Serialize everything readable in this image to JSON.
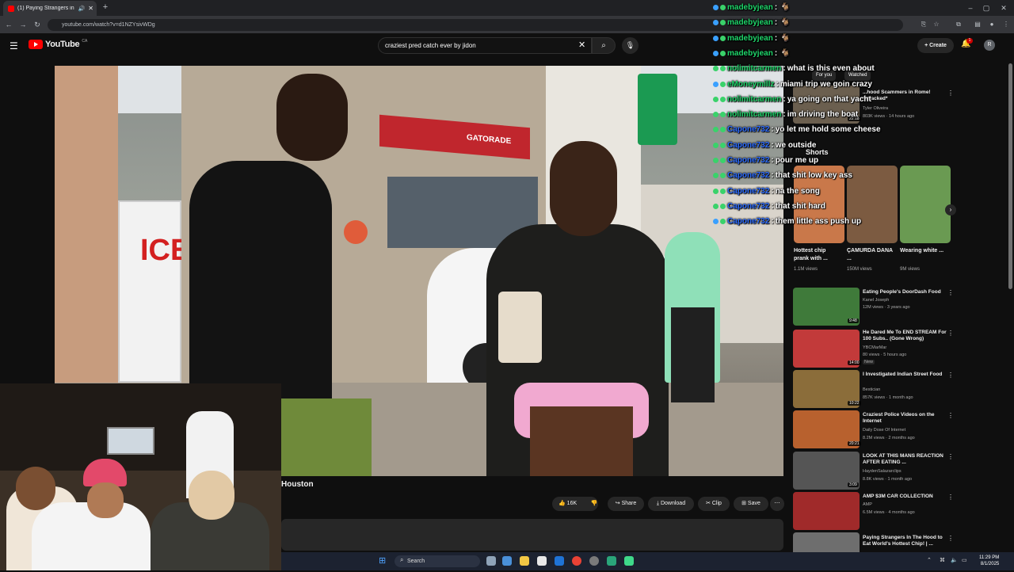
{
  "browser": {
    "tab_title": "(1) Paying Strangers in the...",
    "url": "youtube.com/watch?v=d1NZYsivWDg"
  },
  "header": {
    "logo_text": "YouTube",
    "logo_country": "CA",
    "search_value": "craziest pred catch ever by jidon",
    "create_label": "Create",
    "notification_count": "1",
    "account_initial": "R"
  },
  "video": {
    "title_partial": "Houston",
    "actions": {
      "likes": "16K",
      "share": "Share",
      "download": "Download",
      "clip": "Clip",
      "save": "Save"
    },
    "sign_text": "ICE",
    "gatorade": "GATORADE"
  },
  "chat": [
    {
      "user": "madebyjean",
      "text": "",
      "color": "user-green",
      "badge": "b-blue"
    },
    {
      "user": "madebyjean",
      "text": "",
      "color": "user-green",
      "badge": "b-blue"
    },
    {
      "user": "madebyjean",
      "text": "",
      "color": "user-green",
      "badge": "b-blue"
    },
    {
      "user": "madebyjean",
      "text": "",
      "color": "user-green",
      "badge": "b-blue"
    },
    {
      "user": "nolimitcarmen",
      "text": "what is this even about",
      "color": "user-green",
      "badge": "b-green"
    },
    {
      "user": "eMoneymillz",
      "text": "miami trip we goin crazy",
      "color": "user-green",
      "badge": "b-blue"
    },
    {
      "user": "nolimitcarmen",
      "text": "ya going on that yacht",
      "color": "user-green",
      "badge": "b-green"
    },
    {
      "user": "nolimitcarmen",
      "text": "im driving the boat",
      "color": "user-green",
      "badge": "b-green"
    },
    {
      "user": "Capone732",
      "text": "yo let me hold some cheese",
      "color": "user-blue",
      "badge": "b-green"
    },
    {
      "user": "Capone732",
      "text": "we outside",
      "color": "user-blue",
      "badge": "b-green"
    },
    {
      "user": "Capone732",
      "text": "pour me up",
      "color": "user-blue",
      "badge": "b-green"
    },
    {
      "user": "Capone732",
      "text": "that shit low key ass",
      "color": "user-blue",
      "badge": "b-green"
    },
    {
      "user": "Capone732",
      "text": "na the song",
      "color": "user-blue",
      "badge": "b-green"
    },
    {
      "user": "Capone732",
      "text": "that shit hard",
      "color": "user-blue",
      "badge": "b-green"
    },
    {
      "user": "Capone732",
      "text": "them little ass push up",
      "color": "user-blue",
      "badge": "b-blue"
    }
  ],
  "sidebar": {
    "filters": [
      "For you",
      "Watched"
    ],
    "top_video": {
      "title": "...hood Scammers in Rome! *attacked*",
      "channel": "Tyler Oliveira",
      "meta": "803K views · 14 hours ago",
      "duration": "22:18"
    },
    "shorts_label": "Shorts",
    "shorts": [
      {
        "title": "Hottest chip prank with ...",
        "views": "1.1M views"
      },
      {
        "title": "ÇAMURDA DANA ...",
        "views": "150M views"
      },
      {
        "title": "Wearing white ...",
        "views": "9M views"
      }
    ],
    "videos": [
      {
        "title": "Eating People's DoorDash Food",
        "channel": "Kanel Joseph",
        "meta": "12M views · 3 years ago",
        "duration": "9:48"
      },
      {
        "title": "He Dared Me To END STREAM For 100 Subs.. (Gone Wrong)",
        "channel": "YBCMarMar",
        "meta": "80 views · 5 hours ago",
        "badge": "New",
        "duration": "14:00"
      },
      {
        "title": "I Investigated Indian Street Food",
        "channel": "Bestician",
        "meta": "857K views · 1 month ago",
        "duration": "10:22"
      },
      {
        "title": "Craziest Police Videos on the Internet",
        "channel": "Daily Dose Of Internet",
        "meta": "8.2M views · 2 months ago",
        "duration": "20:21"
      },
      {
        "title": "LOOK AT THIS MANS REACTION AFTER EATING ...",
        "channel": "HaydenSalazarclips",
        "meta": "8.8K views · 1 month ago",
        "duration": "3:09"
      },
      {
        "title": "AMP $3M CAR COLLECTION",
        "channel": "AMP",
        "meta": "6.5M views · 4 months ago",
        "duration": ""
      },
      {
        "title": "Paying Strangers In The Hood to Eat World's Hottest Chip! | ...",
        "channel": "",
        "meta": "",
        "duration": ""
      }
    ]
  },
  "taskbar": {
    "search_label": "Search",
    "time": "11:29 PM",
    "date": "8/1/2025"
  }
}
